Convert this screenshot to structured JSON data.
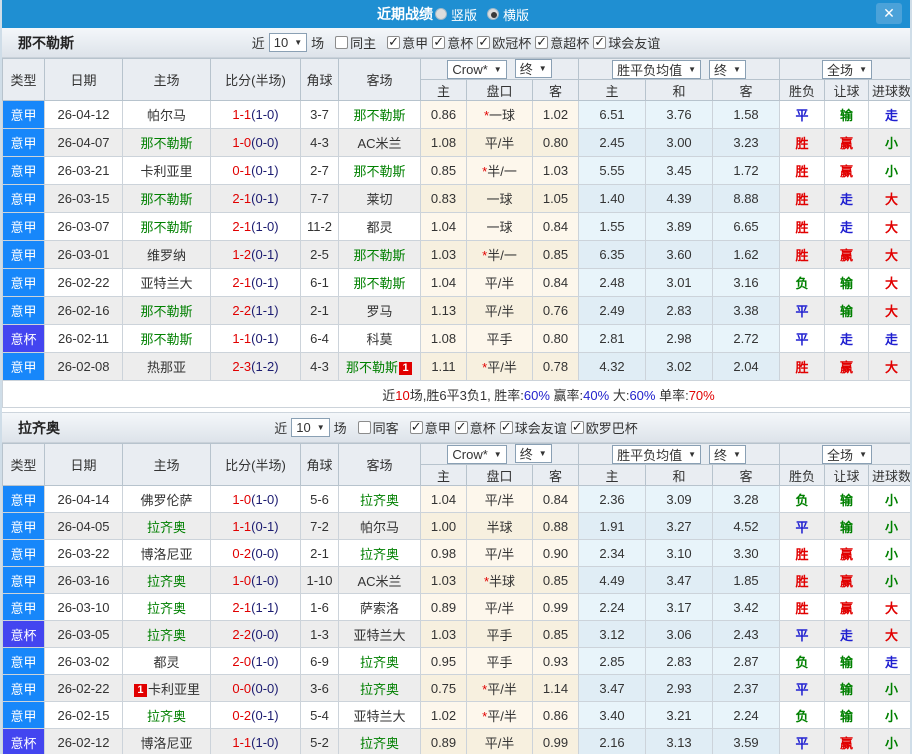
{
  "titlebar": {
    "title": "近期战绩",
    "radio_vertical": "竖版",
    "radio_horizontal": "横版",
    "close_glyph": "✕",
    "selected_mode": "横版"
  },
  "colors": {
    "dark": "#333333",
    "red": "#e10000",
    "blue": "#2222cc",
    "green": "#008000",
    "half": "#1b1b70"
  },
  "league_colors": {
    "意甲": "#1787fa",
    "意杯": "#4345f0"
  },
  "result_colors": {
    "胜": "#e10000",
    "平": "#1f1fd0",
    "负": "#008000",
    "赢": "#e10000",
    "走": "#1f1fd0",
    "输": "#008000",
    "大": "#e10000",
    "小": "#008000"
  },
  "table_header": {
    "static": [
      "类型",
      "日期",
      "主场",
      "比分(半场)",
      "角球",
      "客场"
    ],
    "odds_group": {
      "select1": "Crow*",
      "select2": "终",
      "cols": [
        "主",
        "盘口",
        "客"
      ]
    },
    "mean_group": {
      "select1": "胜平负均值",
      "select2": "终",
      "cols": [
        "主",
        "和",
        "客"
      ]
    },
    "result_group": {
      "select": "全场",
      "cols": [
        "胜负",
        "让球",
        "进球数"
      ]
    }
  },
  "sections": [
    {
      "team": "那不勒斯",
      "filter": {
        "near": "近",
        "count": "10",
        "games": "场",
        "same_label": "同主",
        "same_checked": false,
        "leagues": [
          "意甲",
          "意杯",
          "欧冠杯",
          "意超杯",
          "球会友谊"
        ]
      },
      "rows": [
        {
          "league": "意甲",
          "date": "26-04-12",
          "home": "帕尔马",
          "home_green": false,
          "home_badge": "",
          "score": "1-1",
          "half": "(1-0)",
          "corner": "3-7",
          "away": "那不勒斯",
          "away_green": true,
          "away_badge": "",
          "odds": [
            "0.86",
            "*一球",
            "1.02"
          ],
          "mean": [
            "6.51",
            "3.76",
            "1.58"
          ],
          "result": [
            "平",
            "输",
            "走"
          ]
        },
        {
          "league": "意甲",
          "date": "26-04-07",
          "home": "那不勒斯",
          "home_green": true,
          "home_badge": "",
          "score": "1-0",
          "half": "(0-0)",
          "corner": "4-3",
          "away": "AC米兰",
          "away_green": false,
          "away_badge": "",
          "odds": [
            "1.08",
            "平/半",
            "0.80"
          ],
          "mean": [
            "2.45",
            "3.00",
            "3.23"
          ],
          "result": [
            "胜",
            "赢",
            "小"
          ]
        },
        {
          "league": "意甲",
          "date": "26-03-21",
          "home": "卡利亚里",
          "home_green": false,
          "home_badge": "",
          "score": "0-1",
          "half": "(0-1)",
          "corner": "2-7",
          "away": "那不勒斯",
          "away_green": true,
          "away_badge": "",
          "odds": [
            "0.85",
            "*半/一",
            "1.03"
          ],
          "mean": [
            "5.55",
            "3.45",
            "1.72"
          ],
          "result": [
            "胜",
            "赢",
            "小"
          ]
        },
        {
          "league": "意甲",
          "date": "26-03-15",
          "home": "那不勒斯",
          "home_green": true,
          "home_badge": "",
          "score": "2-1",
          "half": "(0-1)",
          "corner": "7-7",
          "away": "莱切",
          "away_green": false,
          "away_badge": "",
          "odds": [
            "0.83",
            "一球",
            "1.05"
          ],
          "mean": [
            "1.40",
            "4.39",
            "8.88"
          ],
          "result": [
            "胜",
            "走",
            "大"
          ]
        },
        {
          "league": "意甲",
          "date": "26-03-07",
          "home": "那不勒斯",
          "home_green": true,
          "home_badge": "",
          "score": "2-1",
          "half": "(1-0)",
          "corner": "11-2",
          "away": "都灵",
          "away_green": false,
          "away_badge": "",
          "odds": [
            "1.04",
            "一球",
            "0.84"
          ],
          "mean": [
            "1.55",
            "3.89",
            "6.65"
          ],
          "result": [
            "胜",
            "走",
            "大"
          ]
        },
        {
          "league": "意甲",
          "date": "26-03-01",
          "home": "维罗纳",
          "home_green": false,
          "home_badge": "",
          "score": "1-2",
          "half": "(0-1)",
          "corner": "2-5",
          "away": "那不勒斯",
          "away_green": true,
          "away_badge": "",
          "odds": [
            "1.03",
            "*半/一",
            "0.85"
          ],
          "mean": [
            "6.35",
            "3.60",
            "1.62"
          ],
          "result": [
            "胜",
            "赢",
            "大"
          ]
        },
        {
          "league": "意甲",
          "date": "26-02-22",
          "home": "亚特兰大",
          "home_green": false,
          "home_badge": "",
          "score": "2-1",
          "half": "(0-1)",
          "corner": "6-1",
          "away": "那不勒斯",
          "away_green": true,
          "away_badge": "",
          "odds": [
            "1.04",
            "平/半",
            "0.84"
          ],
          "mean": [
            "2.48",
            "3.01",
            "3.16"
          ],
          "result": [
            "负",
            "输",
            "大"
          ]
        },
        {
          "league": "意甲",
          "date": "26-02-16",
          "home": "那不勒斯",
          "home_green": true,
          "home_badge": "",
          "score": "2-2",
          "half": "(1-1)",
          "corner": "2-1",
          "away": "罗马",
          "away_green": false,
          "away_badge": "",
          "odds": [
            "1.13",
            "平/半",
            "0.76"
          ],
          "mean": [
            "2.49",
            "2.83",
            "3.38"
          ],
          "result": [
            "平",
            "输",
            "大"
          ]
        },
        {
          "league": "意杯",
          "date": "26-02-11",
          "home": "那不勒斯",
          "home_green": true,
          "home_badge": "",
          "score": "1-1",
          "half": "(0-1)",
          "corner": "6-4",
          "away": "科莫",
          "away_green": false,
          "away_badge": "",
          "odds": [
            "1.08",
            "平手",
            "0.80"
          ],
          "mean": [
            "2.81",
            "2.98",
            "2.72"
          ],
          "result": [
            "平",
            "走",
            "走"
          ]
        },
        {
          "league": "意甲",
          "date": "26-02-08",
          "home": "热那亚",
          "home_green": false,
          "home_badge": "",
          "score": "2-3",
          "half": "(1-2)",
          "corner": "4-3",
          "away": "那不勒斯",
          "away_green": true,
          "away_badge": "1",
          "odds": [
            "1.11",
            "*平/半",
            "0.78"
          ],
          "mean": [
            "4.32",
            "3.02",
            "2.04"
          ],
          "result": [
            "胜",
            "赢",
            "大"
          ]
        }
      ],
      "summary": [
        {
          "text": "近",
          "color": "dark"
        },
        {
          "text": "10",
          "color": "red"
        },
        {
          "text": "场,胜6平3负1, 胜率:",
          "color": "dark"
        },
        {
          "text": "60%",
          "color": "blue"
        },
        {
          "text": " 赢率:",
          "color": "dark"
        },
        {
          "text": "40%",
          "color": "blue"
        },
        {
          "text": " 大:",
          "color": "dark"
        },
        {
          "text": "60%",
          "color": "blue"
        },
        {
          "text": " 单率:",
          "color": "dark"
        },
        {
          "text": "70%",
          "color": "red"
        }
      ]
    },
    {
      "team": "拉齐奥",
      "filter": {
        "near": "近",
        "count": "10",
        "games": "场",
        "same_label": "同客",
        "same_checked": false,
        "leagues": [
          "意甲",
          "意杯",
          "球会友谊",
          "欧罗巴杯"
        ]
      },
      "rows": [
        {
          "league": "意甲",
          "date": "26-04-14",
          "home": "佛罗伦萨",
          "home_green": false,
          "home_badge": "",
          "score": "1-0",
          "half": "(1-0)",
          "corner": "5-6",
          "away": "拉齐奥",
          "away_green": true,
          "away_badge": "",
          "odds": [
            "1.04",
            "平/半",
            "0.84"
          ],
          "mean": [
            "2.36",
            "3.09",
            "3.28"
          ],
          "result": [
            "负",
            "输",
            "小"
          ]
        },
        {
          "league": "意甲",
          "date": "26-04-05",
          "home": "拉齐奥",
          "home_green": true,
          "home_badge": "",
          "score": "1-1",
          "half": "(0-1)",
          "corner": "7-2",
          "away": "帕尔马",
          "away_green": false,
          "away_badge": "",
          "odds": [
            "1.00",
            "半球",
            "0.88"
          ],
          "mean": [
            "1.91",
            "3.27",
            "4.52"
          ],
          "result": [
            "平",
            "输",
            "小"
          ]
        },
        {
          "league": "意甲",
          "date": "26-03-22",
          "home": "博洛尼亚",
          "home_green": false,
          "home_badge": "",
          "score": "0-2",
          "half": "(0-0)",
          "corner": "2-1",
          "away": "拉齐奥",
          "away_green": true,
          "away_badge": "",
          "odds": [
            "0.98",
            "平/半",
            "0.90"
          ],
          "mean": [
            "2.34",
            "3.10",
            "3.30"
          ],
          "result": [
            "胜",
            "赢",
            "小"
          ]
        },
        {
          "league": "意甲",
          "date": "26-03-16",
          "home": "拉齐奥",
          "home_green": true,
          "home_badge": "",
          "score": "1-0",
          "half": "(1-0)",
          "corner": "1-10",
          "away": "AC米兰",
          "away_green": false,
          "away_badge": "",
          "odds": [
            "1.03",
            "*半球",
            "0.85"
          ],
          "mean": [
            "4.49",
            "3.47",
            "1.85"
          ],
          "result": [
            "胜",
            "赢",
            "小"
          ]
        },
        {
          "league": "意甲",
          "date": "26-03-10",
          "home": "拉齐奥",
          "home_green": true,
          "home_badge": "",
          "score": "2-1",
          "half": "(1-1)",
          "corner": "1-6",
          "away": "萨索洛",
          "away_green": false,
          "away_badge": "",
          "odds": [
            "0.89",
            "平/半",
            "0.99"
          ],
          "mean": [
            "2.24",
            "3.17",
            "3.42"
          ],
          "result": [
            "胜",
            "赢",
            "大"
          ]
        },
        {
          "league": "意杯",
          "date": "26-03-05",
          "home": "拉齐奥",
          "home_green": true,
          "home_badge": "",
          "score": "2-2",
          "half": "(0-0)",
          "corner": "1-3",
          "away": "亚特兰大",
          "away_green": false,
          "away_badge": "",
          "odds": [
            "1.03",
            "平手",
            "0.85"
          ],
          "mean": [
            "3.12",
            "3.06",
            "2.43"
          ],
          "result": [
            "平",
            "走",
            "大"
          ]
        },
        {
          "league": "意甲",
          "date": "26-03-02",
          "home": "都灵",
          "home_green": false,
          "home_badge": "",
          "score": "2-0",
          "half": "(1-0)",
          "corner": "6-9",
          "away": "拉齐奥",
          "away_green": true,
          "away_badge": "",
          "odds": [
            "0.95",
            "平手",
            "0.93"
          ],
          "mean": [
            "2.85",
            "2.83",
            "2.87"
          ],
          "result": [
            "负",
            "输",
            "走"
          ]
        },
        {
          "league": "意甲",
          "date": "26-02-22",
          "home": "卡利亚里",
          "home_green": false,
          "home_badge": "1",
          "score": "0-0",
          "half": "(0-0)",
          "corner": "3-6",
          "away": "拉齐奥",
          "away_green": true,
          "away_badge": "",
          "odds": [
            "0.75",
            "*平/半",
            "1.14"
          ],
          "mean": [
            "3.47",
            "2.93",
            "2.37"
          ],
          "result": [
            "平",
            "输",
            "小"
          ]
        },
        {
          "league": "意甲",
          "date": "26-02-15",
          "home": "拉齐奥",
          "home_green": true,
          "home_badge": "",
          "score": "0-2",
          "half": "(0-1)",
          "corner": "5-4",
          "away": "亚特兰大",
          "away_green": false,
          "away_badge": "",
          "odds": [
            "1.02",
            "*平/半",
            "0.86"
          ],
          "mean": [
            "3.40",
            "3.21",
            "2.24"
          ],
          "result": [
            "负",
            "输",
            "小"
          ]
        },
        {
          "league": "意杯",
          "date": "26-02-12",
          "home": "博洛尼亚",
          "home_green": false,
          "home_badge": "",
          "score": "1-1",
          "half": "(1-0)",
          "corner": "5-2",
          "away": "拉齐奥",
          "away_green": true,
          "away_badge": "",
          "odds": [
            "0.89",
            "平/半",
            "0.99"
          ],
          "mean": [
            "2.16",
            "3.13",
            "3.59"
          ],
          "result": [
            "平",
            "赢",
            "小"
          ]
        }
      ],
      "summary": []
    }
  ]
}
